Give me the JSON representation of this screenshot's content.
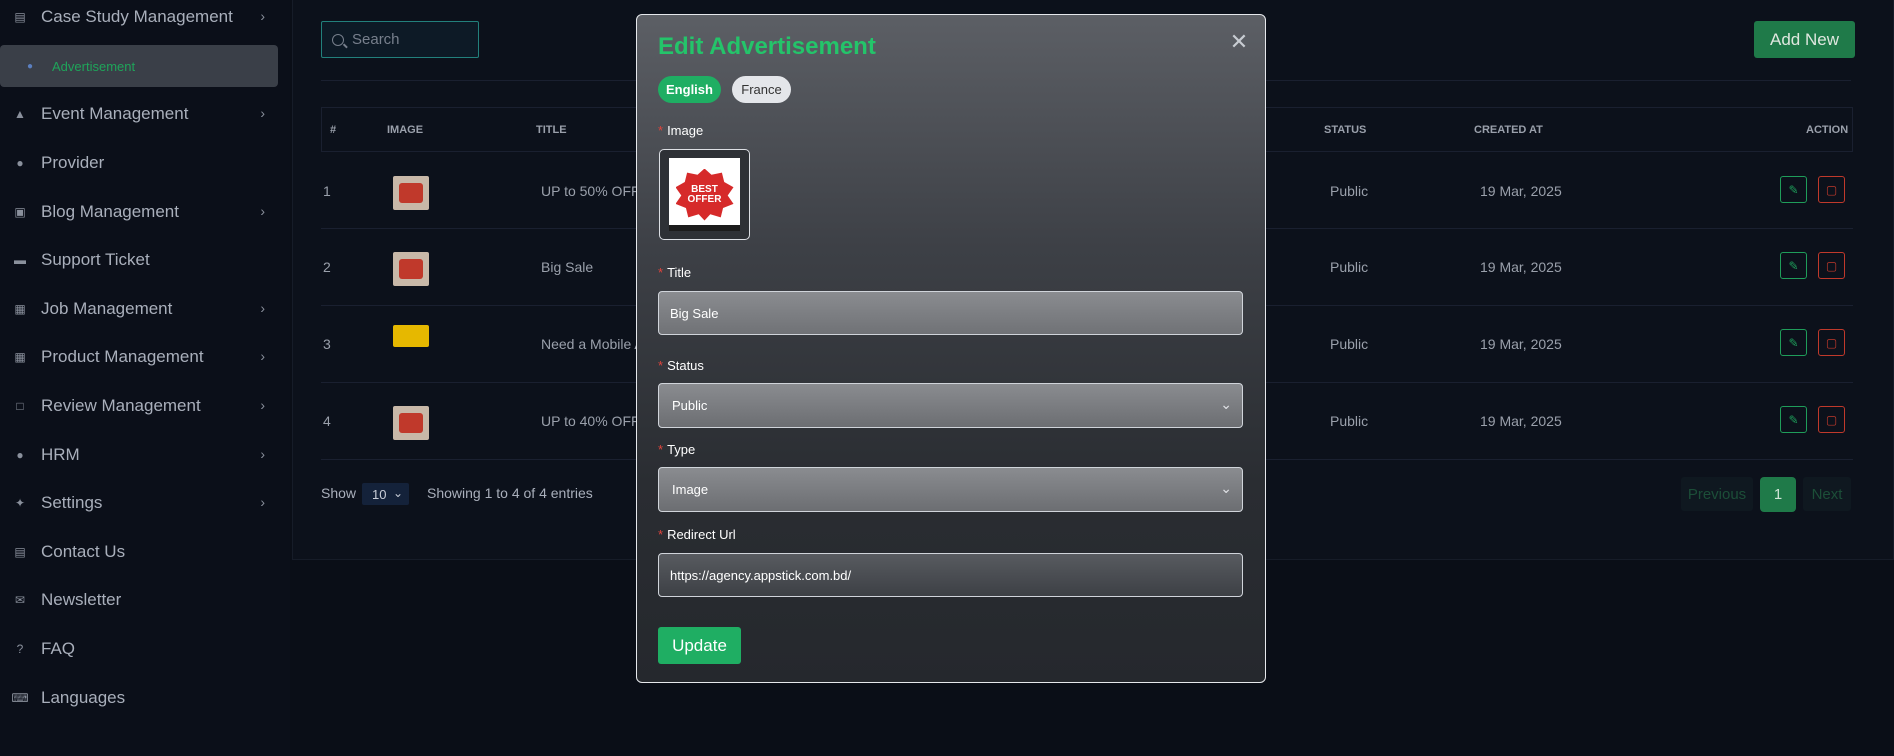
{
  "sidebar": {
    "items": [
      {
        "label": "Case Study Management",
        "icon": "document-icon",
        "has_children": true
      },
      {
        "label": "Advertisement",
        "icon": "megaphone-icon",
        "has_children": false,
        "active": true
      },
      {
        "label": "Event Management",
        "icon": "trophy-icon",
        "has_children": true
      },
      {
        "label": "Provider",
        "icon": "user-icon",
        "has_children": false
      },
      {
        "label": "Blog Management",
        "icon": "blog-icon",
        "has_children": true
      },
      {
        "label": "Support Ticket",
        "icon": "ticket-icon",
        "has_children": false
      },
      {
        "label": "Job Management",
        "icon": "briefcase-icon",
        "has_children": true
      },
      {
        "label": "Product Management",
        "icon": "grid-icon",
        "has_children": true
      },
      {
        "label": "Review Management",
        "icon": "review-icon",
        "has_children": true
      },
      {
        "label": "HRM",
        "icon": "people-icon",
        "has_children": true
      },
      {
        "label": "Settings",
        "icon": "wrench-icon",
        "has_children": true
      },
      {
        "label": "Contact Us",
        "icon": "contact-card-icon",
        "has_children": false
      },
      {
        "label": "Newsletter",
        "icon": "envelope-icon",
        "has_children": false
      },
      {
        "label": "FAQ",
        "icon": "question-icon",
        "has_children": false
      },
      {
        "label": "Languages",
        "icon": "keyboard-icon",
        "has_children": false
      }
    ]
  },
  "toolbar": {
    "search_placeholder": "Search",
    "add_new_label": "Add New"
  },
  "table": {
    "headers": {
      "num": "#",
      "image": "IMAGE",
      "title": "TITLE",
      "status": "STATUS",
      "created_at": "CREATED AT",
      "action": "ACTION"
    },
    "rows": [
      {
        "num": "1",
        "title": "UP to 50% OFF",
        "status": "Public",
        "created_at": "19 Mar, 2025"
      },
      {
        "num": "2",
        "title": "Big Sale",
        "status": "Public",
        "created_at": "19 Mar, 2025"
      },
      {
        "num": "3",
        "title": "Need a Mobile A",
        "status": "Public",
        "created_at": "19 Mar, 2025"
      },
      {
        "num": "4",
        "title": "UP to 40% OFF",
        "status": "Public",
        "created_at": "19 Mar, 2025"
      }
    ]
  },
  "footer": {
    "show_label": "Show",
    "page_size": "10",
    "entries_text": "Showing 1 to 4 of 4 entries",
    "prev_label": "Previous",
    "current_page": "1",
    "next_label": "Next"
  },
  "modal": {
    "title": "Edit Advertisement",
    "close_icon": "close-icon",
    "languages": [
      "English",
      "France"
    ],
    "active_language": "English",
    "image_label": "Image",
    "image_text": "BEST OFFER",
    "title_label": "Title",
    "title_value": "Big Sale",
    "status_label": "Status",
    "status_value": "Public",
    "type_label": "Type",
    "type_value": "Image",
    "redirect_label": "Redirect Url",
    "redirect_value": "https://agency.appstick.com.bd/",
    "update_label": "Update",
    "required_mark": "*"
  },
  "colors": {
    "accent_green": "#1fae63",
    "title_green": "#24c46a",
    "danger_red": "#c0392b",
    "background": "#0a0e17"
  }
}
